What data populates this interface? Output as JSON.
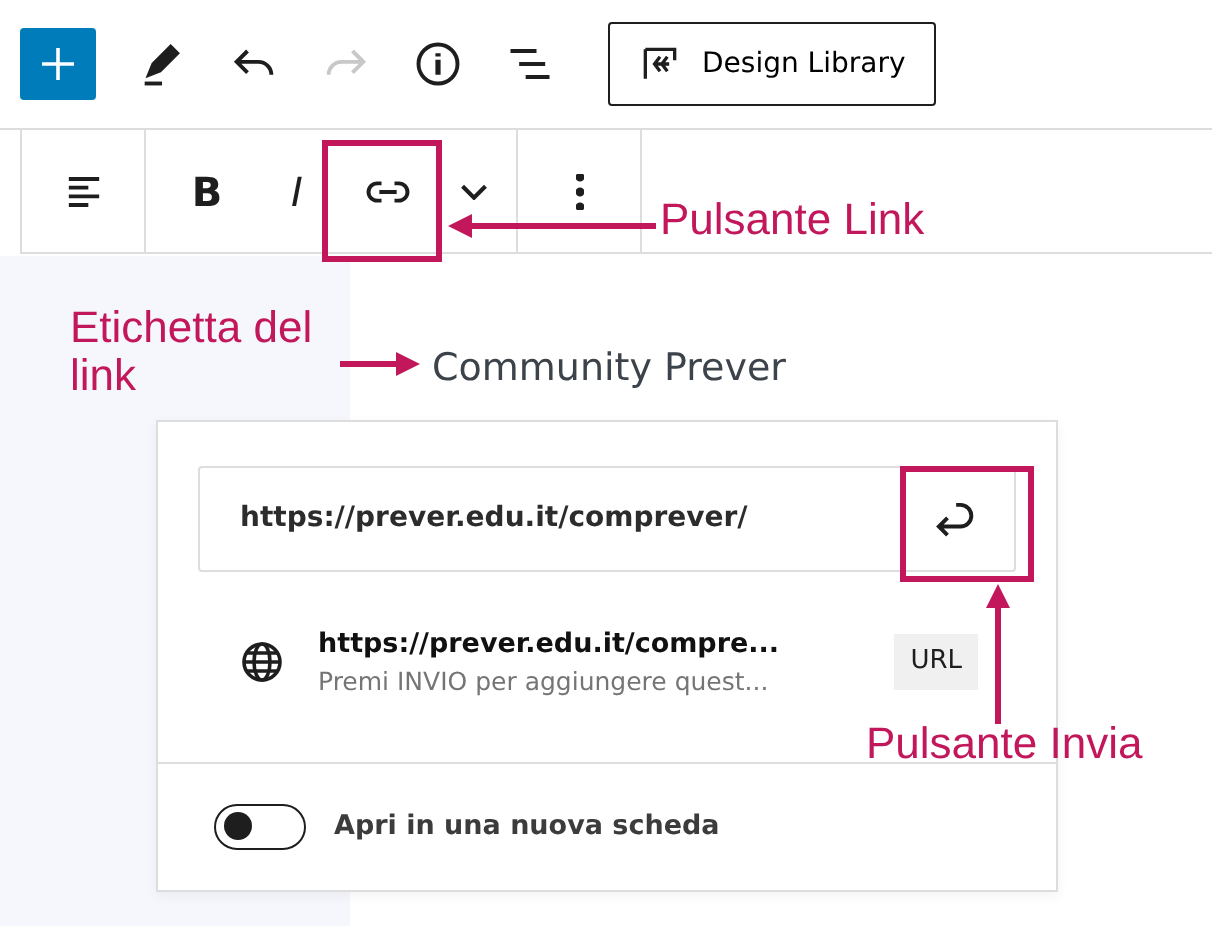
{
  "top_toolbar": {
    "tools": [
      {
        "kind": "add",
        "disabled": false
      },
      {
        "kind": "pen",
        "disabled": false
      },
      {
        "kind": "undo",
        "disabled": false
      },
      {
        "kind": "redo",
        "disabled": true
      },
      {
        "kind": "info",
        "disabled": false
      },
      {
        "kind": "list",
        "disabled": false
      }
    ],
    "design_library_button": "Design Library"
  },
  "block_toolbar": {
    "groups": [
      [
        {
          "kind": "align"
        }
      ],
      [
        {
          "kind": "bold",
          "label": "B"
        },
        {
          "kind": "italic",
          "label": "I"
        },
        {
          "kind": "link"
        },
        {
          "kind": "chevron"
        }
      ],
      [
        {
          "kind": "more"
        }
      ]
    ]
  },
  "paragraph_text": "Community Prever",
  "link_popover": {
    "url_value": "https://prever.edu.it/comprever/",
    "suggestion": {
      "title": "https://prever.edu.it/compre...",
      "hint": "Premi INVIO per aggiungere quest...",
      "type_badge": "URL"
    },
    "new_tab_toggle": {
      "label": "Apri in una nuova scheda",
      "on": false
    }
  },
  "annotations": [
    {
      "kind": "link_button",
      "text": "Pulsante Link"
    },
    {
      "kind": "label",
      "text": "Etichetta del link"
    },
    {
      "kind": "submit_button",
      "text": "Pulsante Invia"
    }
  ]
}
